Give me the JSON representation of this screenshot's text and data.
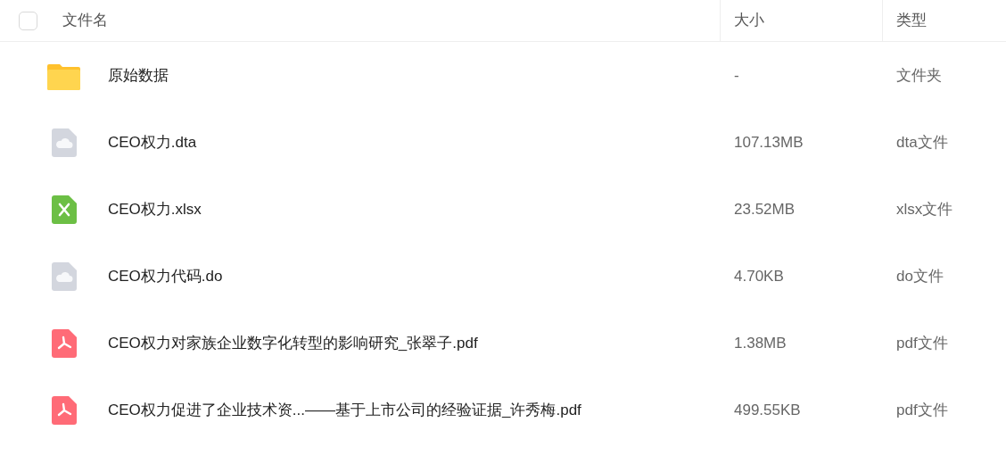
{
  "header": {
    "select_all": {
      "checked": false
    },
    "columns": [
      "文件名",
      "大小",
      "类型"
    ]
  },
  "rows": [
    {
      "kind": "folder",
      "name": "原始数据",
      "size": "-",
      "type": "文件夹"
    },
    {
      "kind": "generic",
      "name": "CEO权力.dta",
      "size": "107.13MB",
      "type": "dta文件"
    },
    {
      "kind": "excel",
      "name": "CEO权力.xlsx",
      "size": "23.52MB",
      "type": "xlsx文件"
    },
    {
      "kind": "generic",
      "name": "CEO权力代码.do",
      "size": "4.70KB",
      "type": "do文件"
    },
    {
      "kind": "pdf",
      "name": "CEO权力对家族企业数字化转型的影响研究_张翠子.pdf",
      "size": "1.38MB",
      "type": "pdf文件"
    },
    {
      "kind": "pdf",
      "name": "CEO权力促进了企业技术资...——基于上市公司的经验证据_许秀梅.pdf",
      "size": "499.55KB",
      "type": "pdf文件"
    }
  ]
}
